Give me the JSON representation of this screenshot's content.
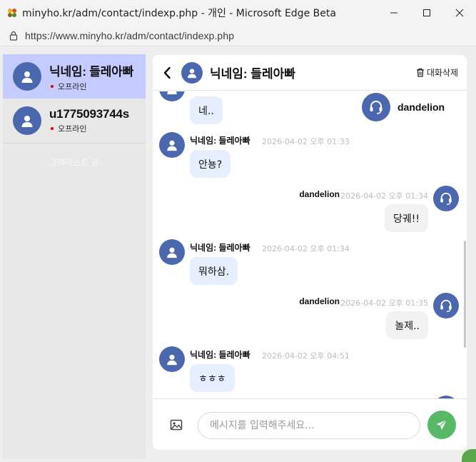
{
  "window": {
    "title": "minyho.kr/adm/contact/indexp.php - 개인 - Microsoft Edge Beta",
    "url": "https://www.minyho.kr/adm/contact/indexp.php"
  },
  "sidebar": {
    "customers": [
      {
        "name": "닉네임: 들레아빠",
        "status": "오프라인",
        "active": true
      },
      {
        "name": "u1775093744s",
        "status": "오프라인",
        "active": false
      }
    ],
    "list_end": "-고객리스트 끝-"
  },
  "chat": {
    "title": "닉네임: 들레아빠",
    "delete_label": "대화삭제",
    "agent_card_name": "dandelion",
    "messages": [
      {
        "direction": "in",
        "text": "네.."
      },
      {
        "direction": "in",
        "sender": "닉네임: 들레아빠",
        "time": "2026-04-02 오후 01:33",
        "text": "안뇽?"
      },
      {
        "direction": "out",
        "sender": "dandelion",
        "time": "2026-04-02 오후 01:34",
        "text": "당궤!!"
      },
      {
        "direction": "in",
        "sender": "닉네임: 들레아빠",
        "time": "2026-04-02 오후 01:34",
        "text": "뭐하삼."
      },
      {
        "direction": "out",
        "sender": "dandelion",
        "time": "2026-04-02 오후 01:35",
        "text": "놀제.."
      },
      {
        "direction": "in",
        "sender": "닉네임: 들레아빠",
        "time": "2026-04-02 오후 04:51",
        "text": "ㅎㅎㅎ"
      }
    ],
    "input_placeholder": "메시지를 입력해주세요..."
  },
  "colors": {
    "avatar": "#4b67ad",
    "active_customer": "#c4cbff",
    "incoming_bubble": "#e5efff",
    "outgoing_bubble": "#f2f2f2",
    "send_button": "#58b868",
    "offline_dot": "#e00000"
  },
  "icons": {
    "app": "flower-icon",
    "lock": "lock-icon",
    "user": "user-icon",
    "agent": "headset-icon",
    "back": "chevron-left-icon",
    "delete": "trash-icon",
    "image": "image-icon",
    "send": "send-icon"
  }
}
